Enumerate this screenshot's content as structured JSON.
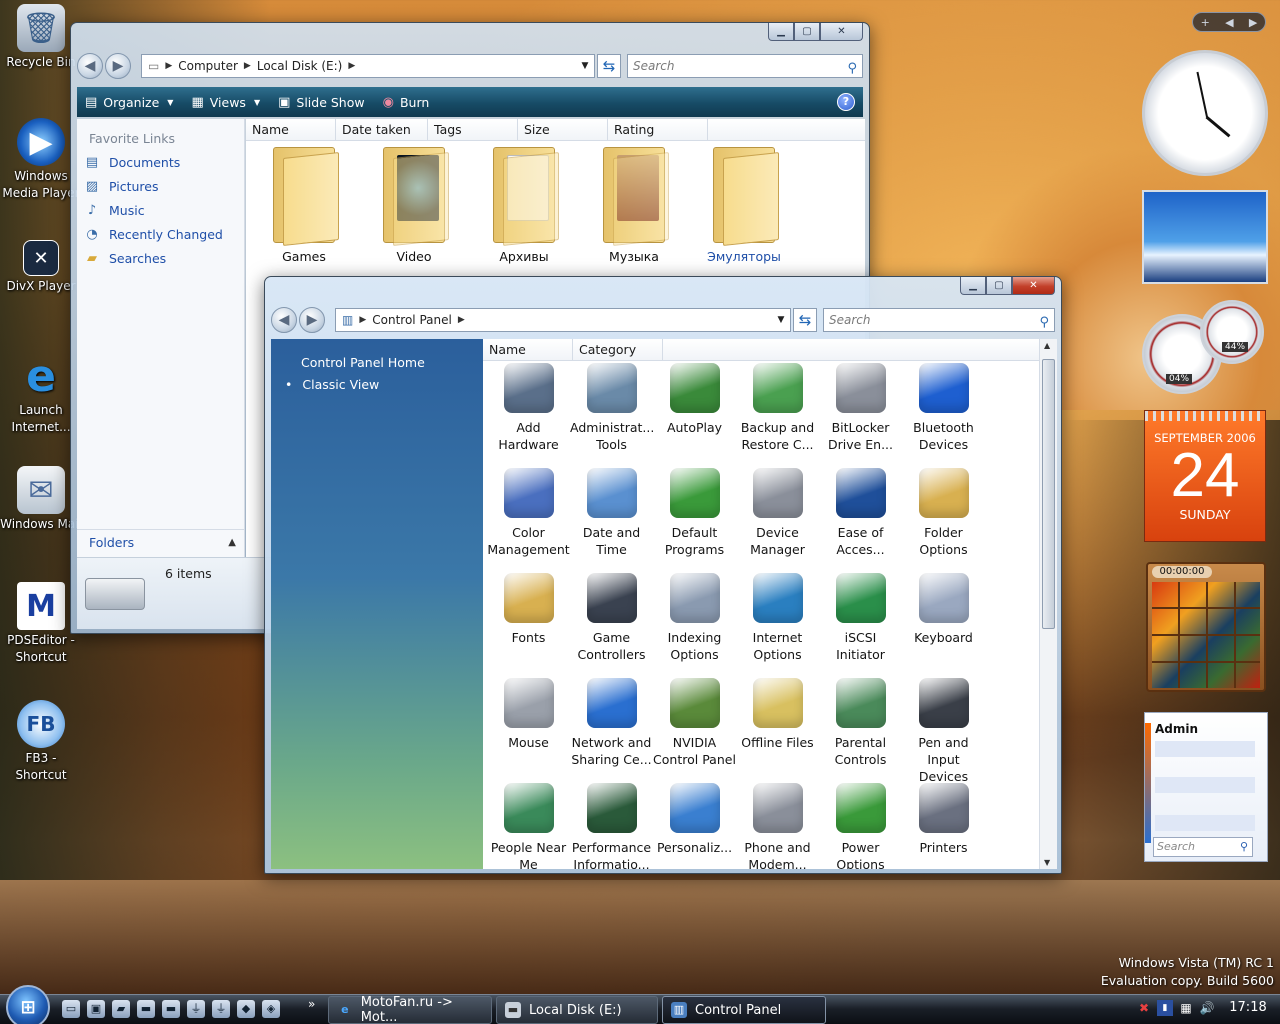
{
  "desktop": {
    "icons": [
      {
        "label": "Recycle Bin",
        "icon": "recycle-bin-icon"
      },
      {
        "label": "Windows Media Player",
        "icon": "media-player-icon"
      },
      {
        "label": "DivX Player",
        "icon": "divx-icon"
      },
      {
        "label": "Launch Internet...",
        "icon": "internet-explorer-icon"
      },
      {
        "label": "Windows Mail",
        "icon": "mail-icon"
      },
      {
        "label": "PDSEditor - Shortcut",
        "icon": "motorola-icon"
      },
      {
        "label": "FB3 - Shortcut",
        "icon": "fb3-icon"
      }
    ],
    "watermark": {
      "line1": "Windows Vista (TM) RC 1",
      "line2": "Evaluation copy. Build 5600"
    }
  },
  "explorer": {
    "breadcrumb": [
      "Computer",
      "Local Disk (E:)"
    ],
    "search_placeholder": "Search",
    "toolbar": {
      "organize": "Organize",
      "views": "Views",
      "slideshow": "Slide Show",
      "burn": "Burn"
    },
    "favorite_links_title": "Favorite Links",
    "favorite_links": [
      "Documents",
      "Pictures",
      "Music",
      "Recently Changed",
      "Searches"
    ],
    "folders_label": "Folders",
    "columns": [
      "Name",
      "Date taken",
      "Tags",
      "Size",
      "Rating"
    ],
    "folders": [
      "Games",
      "Video",
      "Архивы",
      "Музыка",
      "Эмуляторы"
    ],
    "status": "6 items"
  },
  "control_panel": {
    "breadcrumb": [
      "Control Panel"
    ],
    "search_placeholder": "Search",
    "nav": {
      "home": "Control Panel Home",
      "classic": "Classic View"
    },
    "columns": [
      "Name",
      "Category"
    ],
    "items": [
      {
        "label": "Add Hardware",
        "icon": "hardware-icon",
        "color": "#5a6f8a"
      },
      {
        "label": "Administrat... Tools",
        "icon": "admin-tools-icon",
        "color": "#6a8aa8"
      },
      {
        "label": "AutoPlay",
        "icon": "autoplay-icon",
        "color": "#3a8a3a"
      },
      {
        "label": "Backup and Restore C...",
        "icon": "backup-icon",
        "color": "#4aa050"
      },
      {
        "label": "BitLocker Drive En...",
        "icon": "bitlocker-icon",
        "color": "#8a8f9a"
      },
      {
        "label": "Bluetooth Devices",
        "icon": "bluetooth-icon",
        "color": "#1e5fd0"
      },
      {
        "label": "Color Management",
        "icon": "color-management-icon",
        "color": "#4a6fbf"
      },
      {
        "label": "Date and Time",
        "icon": "calendar-clock-icon",
        "color": "#5a90d0"
      },
      {
        "label": "Default Programs",
        "icon": "default-programs-icon",
        "color": "#3a9a3a"
      },
      {
        "label": "Device Manager",
        "icon": "device-manager-icon",
        "color": "#8a8f9a"
      },
      {
        "label": "Ease of Acces...",
        "icon": "ease-of-access-icon",
        "color": "#1f4f9a"
      },
      {
        "label": "Folder Options",
        "icon": "folder-options-icon",
        "color": "#d8b050"
      },
      {
        "label": "Fonts",
        "icon": "fonts-icon",
        "color": "#d8b050"
      },
      {
        "label": "Game Controllers",
        "icon": "gamepad-icon",
        "color": "#3a4250"
      },
      {
        "label": "Indexing Options",
        "icon": "indexing-icon",
        "color": "#8a9ab0"
      },
      {
        "label": "Internet Options",
        "icon": "globe-icon",
        "color": "#2a7fc0"
      },
      {
        "label": "iSCSI Initiator",
        "icon": "iscsi-globe-icon",
        "color": "#2a8f4a"
      },
      {
        "label": "Keyboard",
        "icon": "keyboard-icon",
        "color": "#9aa8c0"
      },
      {
        "label": "Mouse",
        "icon": "mouse-icon",
        "color": "#9aa0aa"
      },
      {
        "label": "Network and Sharing Ce...",
        "icon": "network-icon",
        "color": "#2a6fd0"
      },
      {
        "label": "NVIDIA Control Panel",
        "icon": "nvidia-icon",
        "color": "#5a8a3a"
      },
      {
        "label": "Offline Files",
        "icon": "offline-files-icon",
        "color": "#d8c060"
      },
      {
        "label": "Parental Controls",
        "icon": "parental-controls-icon",
        "color": "#4a8a5a"
      },
      {
        "label": "Pen and Input Devices",
        "icon": "pen-icon",
        "color": "#3a3f48"
      },
      {
        "label": "People Near Me",
        "icon": "people-icon",
        "color": "#3a8a5a"
      },
      {
        "label": "Performance Informatio...",
        "icon": "performance-icon",
        "color": "#2a5a3a"
      },
      {
        "label": "Personaliz...",
        "icon": "personalize-icon",
        "color": "#3a7fd0"
      },
      {
        "label": "Phone and Modem...",
        "icon": "phone-icon",
        "color": "#8a8f9a"
      },
      {
        "label": "Power Options",
        "icon": "power-icon",
        "color": "#3a9a3a"
      },
      {
        "label": "Printers",
        "icon": "printer-icon",
        "color": "#6a7080"
      }
    ]
  },
  "gadgets": {
    "calendar": {
      "month": "SEPTEMBER 2006",
      "day": "24",
      "weekday": "SUNDAY"
    },
    "meter": {
      "cpu": "04%",
      "mem": "44%"
    },
    "puzzle_timer": "00:00:00",
    "contacts": {
      "title": "Admin",
      "search_placeholder": "Search"
    }
  },
  "taskbar": {
    "buttons": [
      "MotoFan.ru -> Mot...",
      "Local Disk (E:)",
      "Control Panel"
    ],
    "clock": "17:18",
    "more": "»"
  }
}
